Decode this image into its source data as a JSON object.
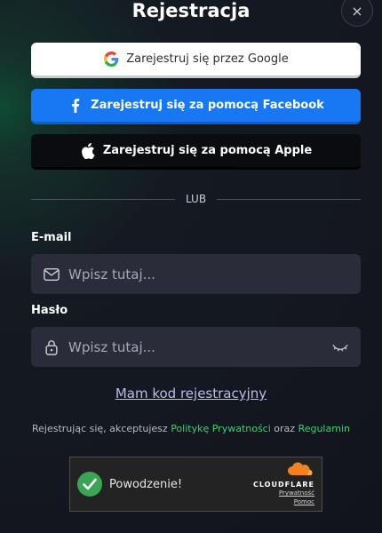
{
  "header": {
    "title": "Rejestracja",
    "close_label": "×"
  },
  "social": {
    "google": "Zarejestruj się przez Google",
    "facebook": "Zarejestruj się za pomocą Facebook",
    "apple": "Zarejestruj się za pomocą Apple"
  },
  "divider": {
    "label": "LUB"
  },
  "form": {
    "email_label": "E-mail",
    "email_placeholder": "Wpisz tutaj...",
    "email_value": "",
    "password_label": "Hasło",
    "password_placeholder": "Wpisz tutaj...",
    "password_value": ""
  },
  "code_link": "Mam kod rejestracyjny",
  "terms": {
    "prefix": "Rejestrując się, akceptujesz ",
    "privacy": "Politykę Prywatności",
    "and": " oraz ",
    "rules": "Regulamin"
  },
  "captcha": {
    "status": "Powodzenie!",
    "brand": "CLOUDFLARE",
    "privacy": "Prywatność",
    "help": "Pomoc"
  },
  "colors": {
    "accent_green": "#3bd16f",
    "facebook_blue": "#1877f2",
    "cloudflare_orange": "#f48120"
  }
}
